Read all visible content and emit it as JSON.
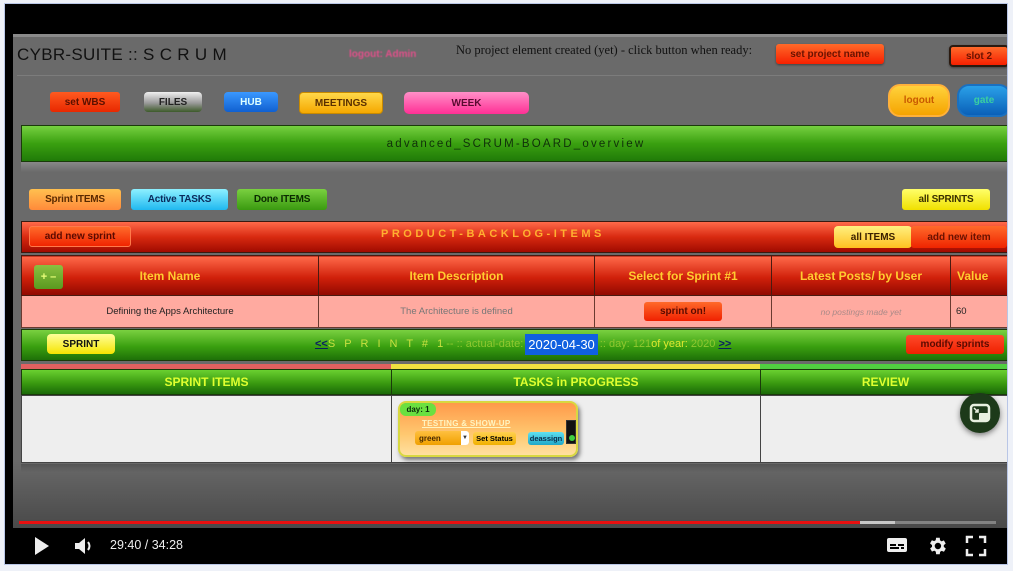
{
  "app": {
    "title": "CYBR-SUITE :: S C R U M",
    "login_info": "logout: Admin",
    "project_message": "No project element created (yet) - click button when ready:",
    "set_project_label": "set project name",
    "slot_label": "slot 2"
  },
  "nav": {
    "buttons": [
      {
        "label": "set WBS"
      },
      {
        "label": "FILES"
      },
      {
        "label": "HUB"
      },
      {
        "label": "MEETINGS"
      },
      {
        "label": "WEEK"
      }
    ],
    "logout_label": "logout",
    "gate_label": "gate"
  },
  "overview": {
    "title": "advanced_SCRUM-BOARD_overview"
  },
  "filters": {
    "sprint_items": "Sprint ITEMS",
    "active_tasks": "Active TASKS",
    "done_items": "Done ITEMS",
    "all_sprints": "all SPRINTS"
  },
  "backlog": {
    "add_sprint_label": "add new sprint",
    "title": "PRODUCT-BACKLOG-ITEMS",
    "all_items_label": "all ITEMS",
    "add_item_label": "add new item",
    "toggle_label": "+ –",
    "columns": [
      "Item Name",
      "Item Description",
      "Select for Sprint #1",
      "Latest Posts/ by User",
      "Value"
    ],
    "rows": [
      {
        "name": "Defining the Apps Architecture",
        "description": "The Architecture is defined",
        "select_label": "sprint on!",
        "posts": "no postings made yet",
        "value": "60"
      }
    ]
  },
  "sprint": {
    "button_label": "SPRINT",
    "prev_link": "<<",
    "sprint_label": "S P R I N T # 1",
    "sep1": " -- :: actual-date:",
    "date": "2020-04-30",
    "sep2": ":: day:",
    "day": "121",
    "year_label": " of year:",
    "year": "2020",
    "next_link": ">>",
    "modify_label": "modify sprints"
  },
  "board": {
    "columns": [
      {
        "label": "SPRINT ITEMS",
        "accent": "#e06060"
      },
      {
        "label": "TASKS in PROGRESS",
        "accent": "#f0e040"
      },
      {
        "label": "REVIEW",
        "accent": "#50d040"
      }
    ],
    "task": {
      "day_label": "day: 1",
      "title": "TESTING & SHOW-UP",
      "status_value": "green",
      "set_status_label": "Set Status",
      "deassign_label": "deassign",
      "light_color": "#40d040"
    }
  },
  "video": {
    "current_time": "29:40",
    "duration": "34:28",
    "time_text": "29:40 / 34:28",
    "played_fraction": 0.861,
    "buffered_fraction": 0.897
  }
}
